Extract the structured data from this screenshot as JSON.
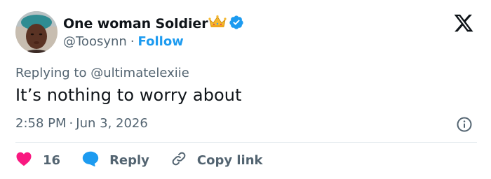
{
  "author": {
    "display_name": "One woman Soldier",
    "handle": "@Toosynn",
    "separator": "·",
    "follow_label": "Follow",
    "verified": true,
    "verified_color": "#1d9bf0",
    "crown_emoji": "crown-icon"
  },
  "reply_context": {
    "prefix": "Replying to",
    "mention": "@ultimatelexiie"
  },
  "tweet": {
    "text": "It’s nothing to worry about",
    "time": "2:58 PM",
    "separator": "·",
    "date": "Jun 3, 2026"
  },
  "actions": {
    "like_count": "16",
    "reply_label": "Reply",
    "copy_link_label": "Copy link"
  },
  "colors": {
    "like": "#f91880",
    "reply": "#1d9bf0",
    "link": "#1d9bf0",
    "secondary_text": "#536471",
    "primary_text": "#0f1419"
  },
  "icons": [
    "avatar",
    "crown-icon",
    "verified-icon",
    "x-logo-icon",
    "info-icon",
    "heart-icon",
    "reply-bubble-icon",
    "link-icon"
  ]
}
